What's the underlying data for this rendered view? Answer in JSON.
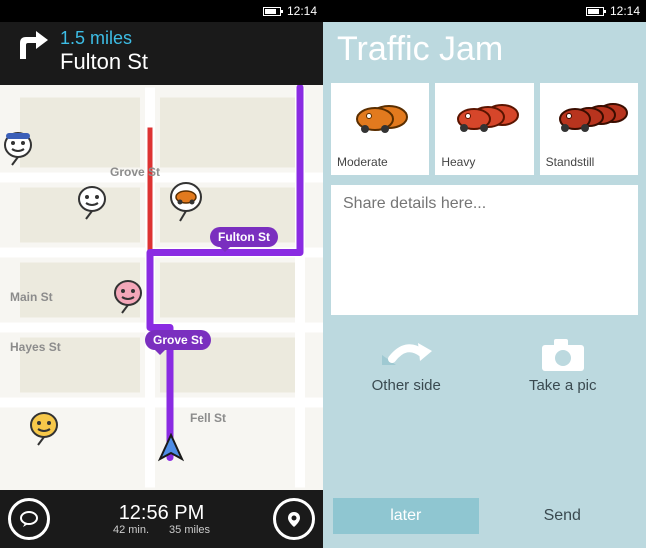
{
  "statusbar": {
    "time": "12:14"
  },
  "nav": {
    "distance": "1.5 miles",
    "street": "Fulton St"
  },
  "map": {
    "streets": {
      "grove": "Grove St",
      "fulton": "Fulton St",
      "main": "Main St",
      "hayes": "Hayes St",
      "fell": "Fell St"
    },
    "bubbles": {
      "fulton": "Fulton St",
      "grove": "Grove St"
    }
  },
  "bottom": {
    "time": "12:56 PM",
    "eta": "42 min.",
    "dist": "35 miles"
  },
  "report": {
    "title": "Traffic Jam",
    "levels": [
      "Moderate",
      "Heavy",
      "Standstill"
    ],
    "details_placeholder": "Share details here...",
    "other_side": "Other side",
    "take_pic": "Take a pic",
    "later": "later",
    "send": "Send"
  },
  "colors": {
    "route": "#8a2be2",
    "accent_teal": "#3dbde5",
    "tj_bg": "#bcd9df",
    "car_orange": "#e27a1e",
    "car_red_dk": "#b8341e",
    "car_red": "#d6462a"
  }
}
